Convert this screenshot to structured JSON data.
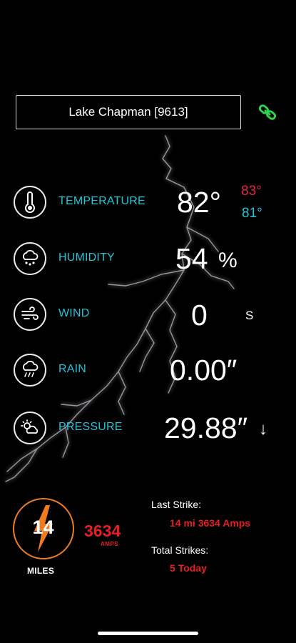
{
  "station": {
    "name": "Lake Chapman  [9613]"
  },
  "rows": {
    "temperature": {
      "label": "TEMPERATURE",
      "value": "82°",
      "high": "83°",
      "low": "81°"
    },
    "humidity": {
      "label": "HUMIDITY",
      "value": "54",
      "unit": "%"
    },
    "wind": {
      "label": "WIND",
      "value": "0",
      "direction": "S"
    },
    "rain": {
      "label": "RAIN",
      "value": "0.00″"
    },
    "pressure": {
      "label": "PRESSURE",
      "value": "29.88″",
      "trend": "↓"
    }
  },
  "lightning": {
    "distance": "14",
    "distance_unit": "MILES",
    "amps": "3634",
    "amps_unit": "AMPS",
    "last_strike_label": "Last Strike:",
    "last_strike_value": "14 mi 3634 Amps",
    "total_strikes_label": "Total Strikes:",
    "total_strikes_value": "5 Today"
  },
  "colors": {
    "accent_cyan": "#1fc5d9",
    "high_red": "#e8234a",
    "strike_red": "#e81e25",
    "strike_orange": "#f07b21",
    "link_green": "#2fd14f"
  },
  "icons": [
    "link-icon",
    "thermometer-icon",
    "humidity-cloud-icon",
    "wind-icon",
    "rain-cloud-icon",
    "partly-cloudy-icon",
    "lightning-bolt-icon"
  ]
}
